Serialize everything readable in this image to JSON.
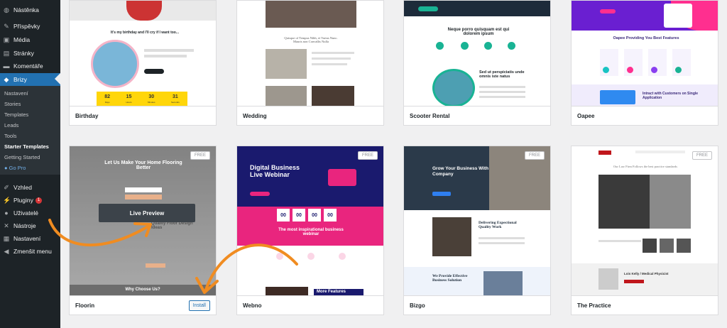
{
  "sidebar": {
    "items": [
      {
        "label": "Nástěnka",
        "icon": "dashboard-icon"
      },
      {
        "label": "Příspěvky",
        "icon": "pin-icon"
      },
      {
        "label": "Média",
        "icon": "media-icon"
      },
      {
        "label": "Stránky",
        "icon": "pages-icon"
      },
      {
        "label": "Komentáře",
        "icon": "comments-icon"
      },
      {
        "label": "Brizy",
        "icon": "brizy-icon"
      },
      {
        "label": "Vzhled",
        "icon": "appearance-icon"
      },
      {
        "label": "Pluginy",
        "icon": "plugins-icon",
        "badge": "1"
      },
      {
        "label": "Uživatelé",
        "icon": "users-icon"
      },
      {
        "label": "Nástroje",
        "icon": "tools-icon"
      },
      {
        "label": "Nastavení",
        "icon": "settings-icon"
      },
      {
        "label": "Zmenšit menu",
        "icon": "collapse-icon"
      }
    ],
    "submenu": [
      "Nastavení",
      "Stories",
      "Templates",
      "Leads",
      "Tools",
      "Starter Templates",
      "Getting Started",
      "Go Pro"
    ]
  },
  "cards": {
    "birthday": {
      "name": "Birthday",
      "headline": "It's my birthday and I'll cry if I want too...",
      "countdown": [
        "82",
        "15",
        "30",
        "31"
      ],
      "countdown_units": [
        "Days",
        "Hours",
        "Minutes",
        "Seconds"
      ]
    },
    "wedding": {
      "name": "Wedding",
      "text": "Quisque of Tempus Nibh, et Varius Nunc. Mauris non Convallis Nulla"
    },
    "scooter": {
      "name": "Scooter Rental",
      "heading": "Neque porro quisquam est qui dolorem ipsum",
      "subheading": "Sed ut perspiciatis unde omnis iste natus"
    },
    "oapee": {
      "name": "Oapee",
      "heading": "Oapee Providing You Best Features",
      "footer": "Intract with Customers on Single Application"
    },
    "floorin": {
      "name": "Floorin",
      "free": "FREE",
      "headline": "Let Us Make Your Home Flooring Better",
      "mid": "Quality Floor Design Ideas",
      "bottom": "Why Choose Us?",
      "preview": "Live Preview",
      "install": "Install"
    },
    "webno": {
      "name": "Webno",
      "free": "FREE",
      "headline": "Digital Business Live Webinar",
      "countdown": [
        "00",
        "00",
        "00",
        "00"
      ],
      "banner": "The most inspirational business webinar",
      "more": "More Features"
    },
    "bizgo": {
      "name": "Bizgo",
      "free": "FREE",
      "headline": "Grow Your Business With Company",
      "quality": "Delivering Expectional Quality Work",
      "solution": "We Provide Effective Business Solution"
    },
    "practice": {
      "name": "The Practice",
      "free": "FREE",
      "intro": "Our Law Firm Follows the best practice standards",
      "name_line": "Lois Kelly / Medical Physicist"
    }
  },
  "colors": {
    "sidebar": "#1d2327",
    "active": "#2271b1",
    "arrow": "#f08c21",
    "webno_magenta": "#e9257e",
    "birthday_yellow": "#ffd60a"
  }
}
